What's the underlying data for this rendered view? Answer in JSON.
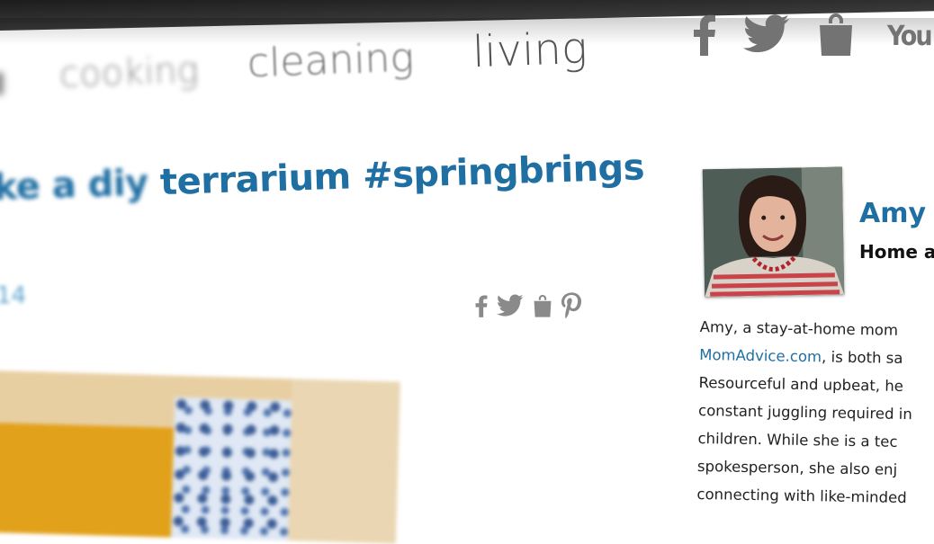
{
  "nav": {
    "items": [
      "cooking",
      "cleaning",
      "living"
    ]
  },
  "social": {
    "top_icons": [
      "facebook-icon",
      "twitter-icon",
      "shopping-bag-icon",
      "youtube-icon"
    ],
    "youtube_text": "You"
  },
  "post": {
    "title_blurred": "ke a diy",
    "title_clear": " terrarium #springbrings",
    "date_fragment": "14",
    "share_icons": [
      "facebook-icon",
      "twitter-icon",
      "shopping-bag-icon",
      "pinterest-icon"
    ]
  },
  "author": {
    "name": "Amy",
    "role": "Home a",
    "bio_lines": [
      "Amy, a stay-at-home mom",
      ", is both sa",
      "Resourceful and upbeat, he",
      "constant juggling required in",
      "children. While she is a tec",
      "spokesperson, she also enj",
      "connecting with like-minded"
    ],
    "bio_link": "MomAdvice.com"
  },
  "colors": {
    "accent": "#1f6fa3",
    "nav_text": "#6b6b6b",
    "icon_gray": "#737373"
  }
}
